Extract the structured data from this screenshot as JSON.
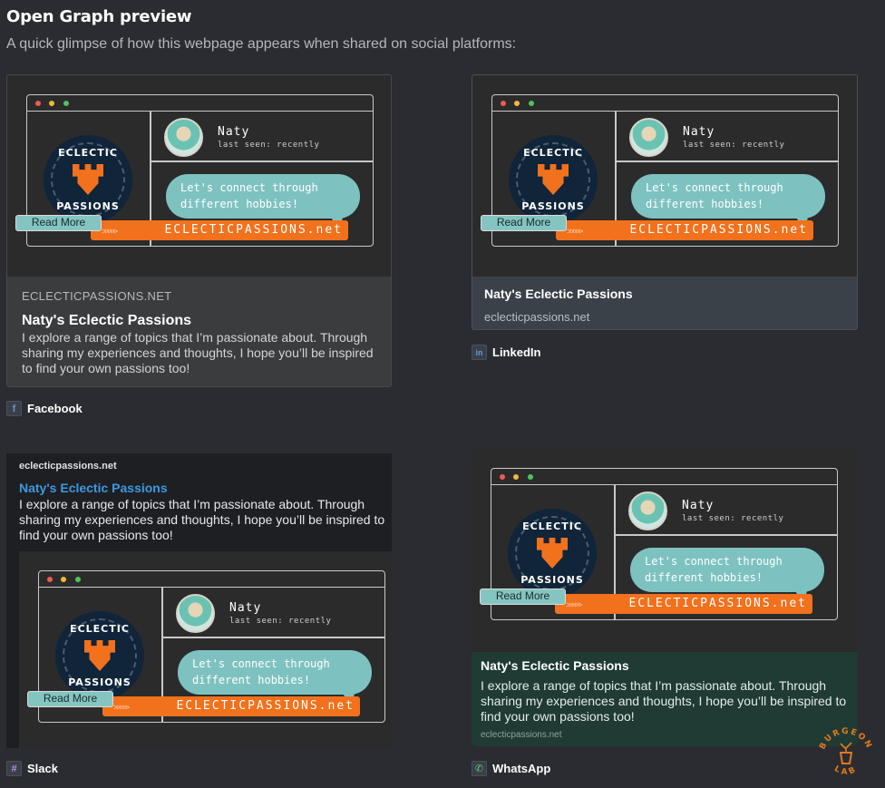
{
  "page": {
    "title": "Open Graph preview",
    "subtitle": "A quick glimpse of how this webpage appears when shared on social platforms:"
  },
  "og_image": {
    "logo_top": "ECLECTIC",
    "logo_bottom": "PASSIONS",
    "name": "Naty",
    "last_seen": "last seen: recently",
    "bubble_line1": "Let's connect through",
    "bubble_line2": "different hobbies!",
    "read_more": "Read More",
    "banner": "ECLECTICPASSIONS.net"
  },
  "facebook": {
    "domain": "ECLECTICPASSIONS.NET",
    "title": "Naty's Eclectic Passions",
    "description": "I explore a range of topics that I’m passionate about. Through sharing my experiences and thoughts, I hope you’ll be inspired to find your own passions too!",
    "platform": "Facebook",
    "icon": "f"
  },
  "linkedin": {
    "title": "Naty's Eclectic Passions",
    "domain": "eclecticpassions.net",
    "platform": "LinkedIn",
    "icon": "in"
  },
  "slack": {
    "site": "eclecticpassions.net",
    "title": "Naty's Eclectic Passions",
    "description": "I explore a range of topics that I’m passionate about. Through sharing my experiences and thoughts, I hope you’ll be inspired to find your own passions too!",
    "platform": "Slack",
    "icon": "#"
  },
  "whatsapp": {
    "title": "Naty's Eclectic Passions",
    "description": "I explore a range of topics that I’m passionate about. Through sharing my experiences and thoughts, I hope you’ll be inspired to find your own passions too!",
    "domain": "eclecticpassions.net",
    "platform": "WhatsApp",
    "icon": "✆"
  },
  "watermark": {
    "text_top": "BURGEON",
    "text_bottom": "LAB"
  },
  "colors": {
    "background": "#2a2c31",
    "accent_orange": "#f2711c",
    "bubble_teal": "#7dc2c0",
    "slack_link": "#3b9ae0",
    "whatsapp_bg": "#1f3b33",
    "linkedin_bg": "#3a4149"
  }
}
